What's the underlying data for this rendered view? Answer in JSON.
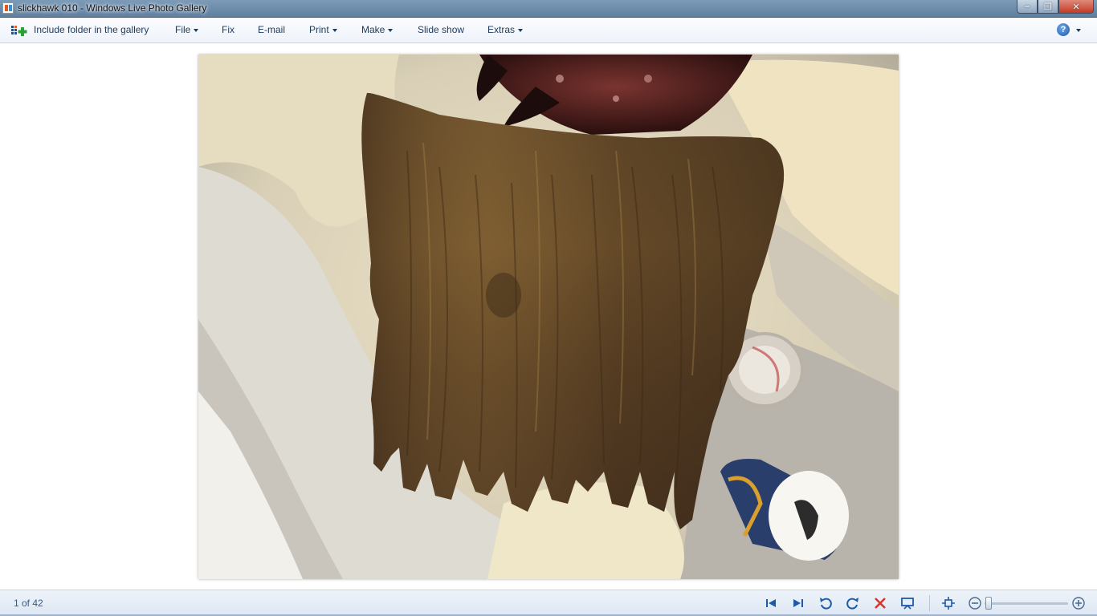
{
  "window": {
    "title": "slickhawk 010 - Windows Live Photo Gallery",
    "controls": {
      "minimize": "–",
      "restore": "❐",
      "close": "✕"
    }
  },
  "toolbar": {
    "include_folder_label": "Include folder in the gallery",
    "menus": [
      {
        "label": "File",
        "has_dropdown": true
      },
      {
        "label": "Fix",
        "has_dropdown": false
      },
      {
        "label": "E-mail",
        "has_dropdown": false
      },
      {
        "label": "Print",
        "has_dropdown": true
      },
      {
        "label": "Make",
        "has_dropdown": true
      },
      {
        "label": "Slide show",
        "has_dropdown": false
      },
      {
        "label": "Extras",
        "has_dropdown": true
      }
    ],
    "help_glyph": "?"
  },
  "viewer": {
    "image_subject": "brown latex prop piece resting in a plaster mold"
  },
  "statusbar": {
    "position_text": "1 of 42",
    "buttons": [
      "previous-icon",
      "next-icon",
      "rotate-left-icon",
      "rotate-right-icon",
      "delete-icon",
      "slideshow-icon",
      "actual-size-icon",
      "zoom-out-icon",
      "zoom-in-icon"
    ]
  },
  "colors": {
    "accent": "#1e395b",
    "delete_red": "#d9342b",
    "nav_blue": "#1d5aa8"
  }
}
